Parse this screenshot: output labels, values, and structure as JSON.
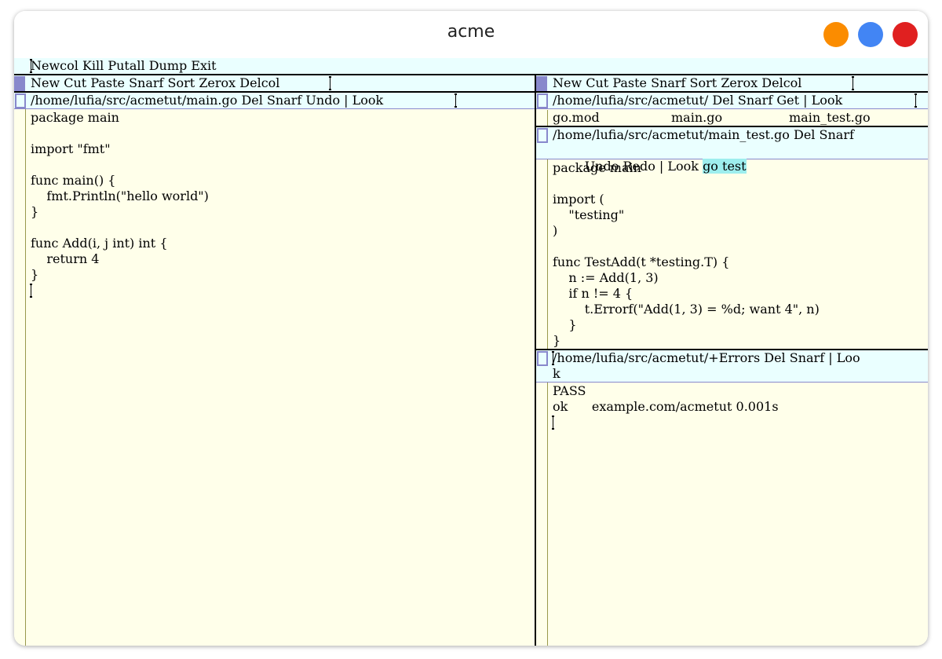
{
  "window": {
    "title": "acme",
    "buttons": [
      {
        "name": "minimize",
        "color": "#fb8c00"
      },
      {
        "name": "maximize",
        "color": "#4285f4"
      },
      {
        "name": "close",
        "color": "#e02020"
      }
    ]
  },
  "colors": {
    "tag_bg": "#eaffff",
    "body_bg": "#ffffea",
    "handle": "#8888cc",
    "selection": "#9eeeee",
    "scrollbar": "#99994c"
  },
  "main_tag": "Newcol Kill Putall Dump Exit",
  "left_column": {
    "tag": "New Cut Paste Snarf Sort Zerox Delcol",
    "window": {
      "tag": "/home/lufia/src/acmetut/main.go Del Snarf Undo | Look",
      "body": "package main\n\nimport \"fmt\"\n\nfunc main() {\n    fmt.Println(\"hello world\")\n}\n\nfunc Add(i, j int) int {\n    return 4\n}"
    }
  },
  "right_column": {
    "tag": "New Cut Paste Snarf Sort Zerox Delcol",
    "dir_window": {
      "tag": "/home/lufia/src/acmetut/ Del Snarf Get | Look",
      "files": [
        "go.mod",
        "main.go",
        "main_test.go"
      ]
    },
    "test_window": {
      "tag_line1": "/home/lufia/src/acmetut/main_test.go Del Snarf",
      "tag_line2": "Undo Redo | Look ",
      "tag_selected": "go test",
      "body": "package main\n\nimport (\n    \"testing\"\n)\n\nfunc TestAdd(t *testing.T) {\n    n := Add(1, 3)\n    if n != 4 {\n        t.Errorf(\"Add(1, 3) = %d; want 4\", n)\n    }\n}"
    },
    "errors_window": {
      "tag_line1": "/home/lufia/src/acmetut/+Errors Del Snarf | Loo",
      "tag_line2": "k",
      "body": "PASS\nok      example.com/acmetut 0.001s"
    }
  }
}
